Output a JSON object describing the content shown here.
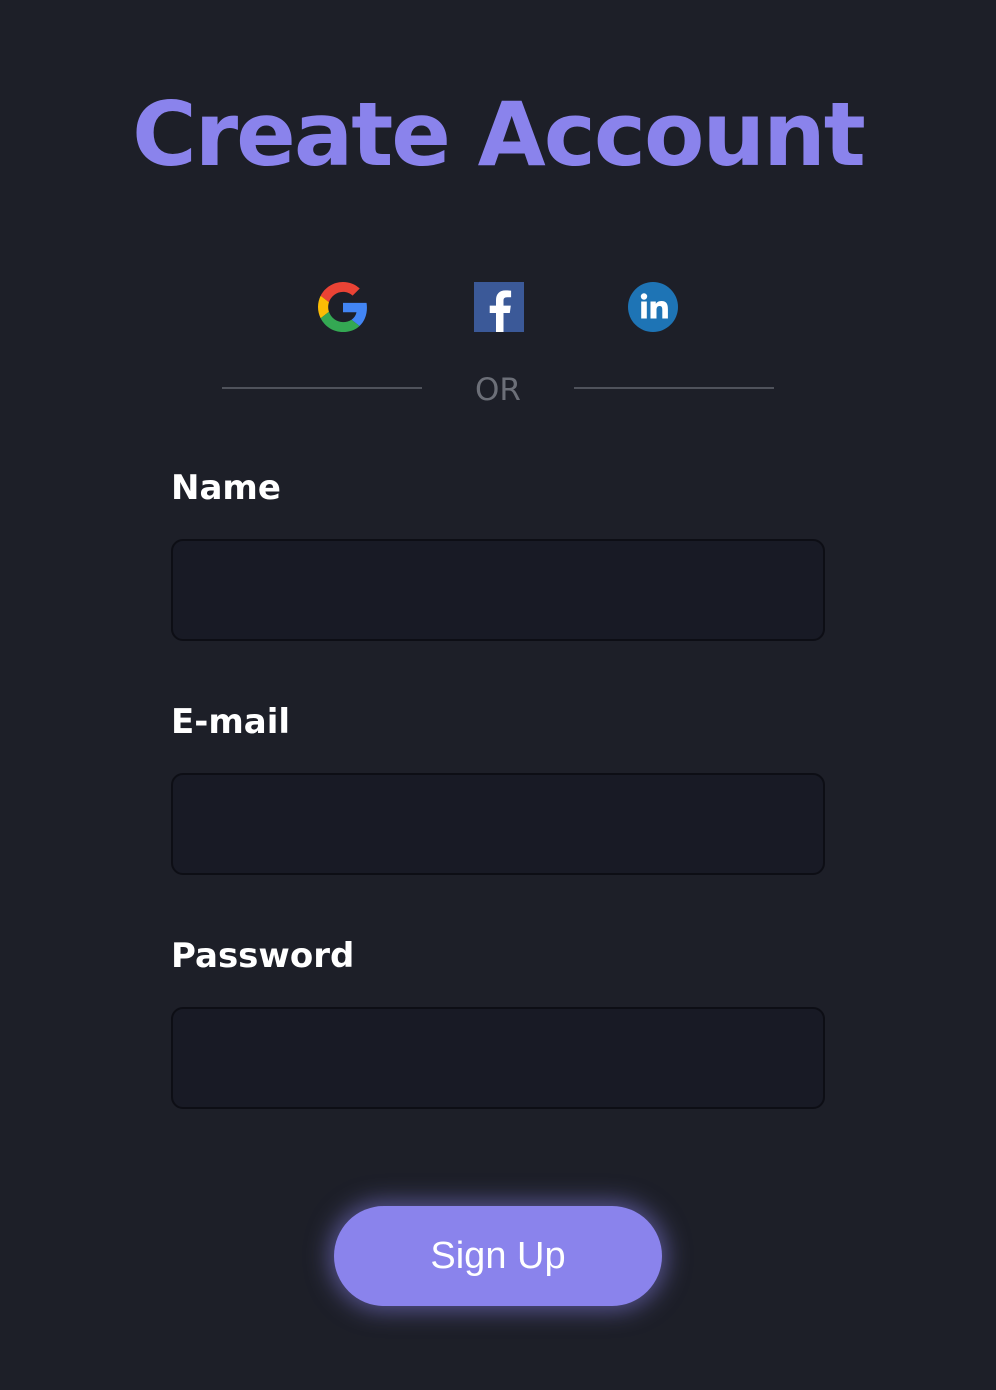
{
  "page": {
    "title": "Create Account",
    "title_color": "#8a83ec",
    "background_color": "#1d1f28"
  },
  "social": {
    "providers": [
      {
        "name": "Google",
        "icon": "google-icon"
      },
      {
        "name": "Facebook",
        "icon": "facebook-icon",
        "color": "#3b5998"
      },
      {
        "name": "LinkedIn",
        "icon": "linkedin-icon",
        "color": "#1e74b5"
      }
    ]
  },
  "divider": {
    "text": "OR"
  },
  "form": {
    "fields": [
      {
        "label": "Name",
        "value": "",
        "placeholder": ""
      },
      {
        "label": "E-mail",
        "value": "",
        "placeholder": ""
      },
      {
        "label": "Password",
        "value": "",
        "placeholder": ""
      }
    ],
    "submit_label": "Sign Up",
    "accent_color": "#8a83ec"
  }
}
